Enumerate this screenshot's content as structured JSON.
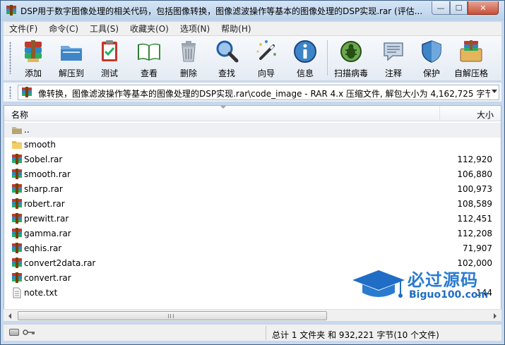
{
  "window": {
    "title": "DSP用于数字图像处理的相关代码，包括图像转换，图像滤波操作等基本的图像处理的DSP实现.rar (评估...",
    "minimize_label": "—",
    "maximize_label": "☐",
    "close_label": "✕"
  },
  "menu": {
    "items": [
      {
        "label": "文件(F)"
      },
      {
        "label": "命令(C)"
      },
      {
        "label": "工具(S)"
      },
      {
        "label": "收藏夹(O)"
      },
      {
        "label": "选项(N)"
      },
      {
        "label": "帮助(H)"
      }
    ]
  },
  "toolbar": {
    "add": "添加",
    "extract": "解压到",
    "test": "测试",
    "view": "查看",
    "delete": "删除",
    "find": "查找",
    "wizard": "向导",
    "info": "信息",
    "virus": "扫描病毒",
    "comment": "注释",
    "protect": "保护",
    "sfx": "自解压格"
  },
  "address": {
    "path": "像转换，图像滤波操作等基本的图像处理的DSP实现.rar\\code_image - RAR 4.x 压缩文件, 解包大小为 4,162,725 字节"
  },
  "filelist": {
    "col_name": "名称",
    "col_size": "大小",
    "rows": [
      {
        "name": "..",
        "size": "",
        "type": "parent"
      },
      {
        "name": "smooth",
        "size": "",
        "type": "folder"
      },
      {
        "name": "Sobel.rar",
        "size": "112,920",
        "type": "rar"
      },
      {
        "name": "smooth.rar",
        "size": "106,880",
        "type": "rar"
      },
      {
        "name": "sharp.rar",
        "size": "100,973",
        "type": "rar"
      },
      {
        "name": "robert.rar",
        "size": "108,589",
        "type": "rar"
      },
      {
        "name": "prewitt.rar",
        "size": "112,451",
        "type": "rar"
      },
      {
        "name": "gamma.rar",
        "size": "112,208",
        "type": "rar"
      },
      {
        "name": "eqhis.rar",
        "size": "71,907",
        "type": "rar"
      },
      {
        "name": "convert2data.rar",
        "size": "102,000",
        "type": "rar"
      },
      {
        "name": "convert.rar",
        "size": "",
        "type": "rar"
      },
      {
        "name": "note.txt",
        "size": "144",
        "type": "txt"
      }
    ]
  },
  "status": {
    "summary": "总计 1 文件夹 和 932,221 字节(10 个文件)"
  },
  "watermark": {
    "cn": "必过源码",
    "en": "Biguo100.com"
  },
  "colors": {
    "accent": "#2a7bd0",
    "window_frame": "#c7d9ee"
  }
}
